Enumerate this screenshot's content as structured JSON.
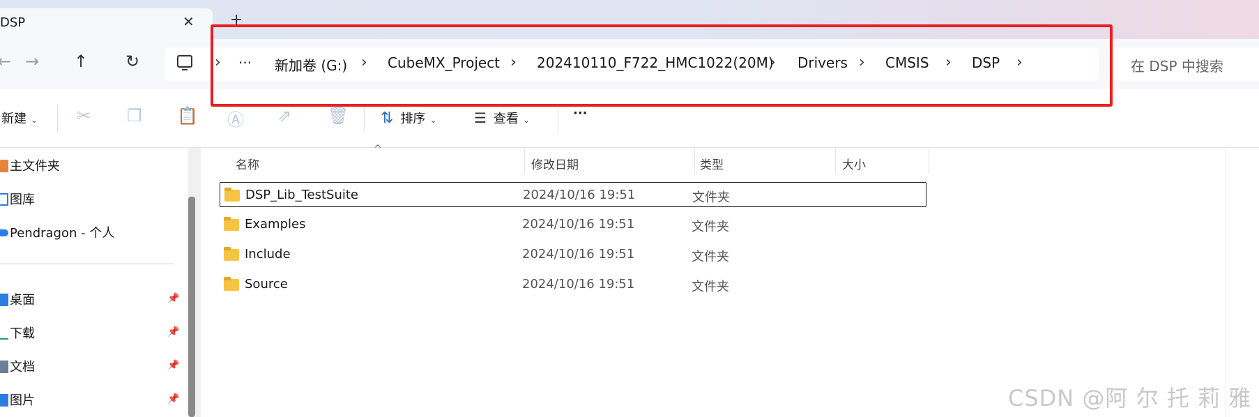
{
  "tab": {
    "title": "DSP",
    "close_icon": "close-icon",
    "new_tab_icon": "plus-icon"
  },
  "nav": {
    "back_icon": "arrow-left-icon",
    "forward_icon": "arrow-right-icon",
    "up_icon": "arrow-up-icon",
    "refresh_icon": "refresh-icon"
  },
  "address": {
    "pc_icon": "this-pc-icon",
    "more": "···",
    "crumbs": [
      "新加卷 (G:)",
      "CubeMX_Project",
      "202410110_F722_HMC1022(20M)",
      "Drivers",
      "CMSIS",
      "DSP"
    ],
    "separator": "›"
  },
  "search": {
    "placeholder": "在 DSP 中搜索"
  },
  "toolbar": {
    "new_label": "新建",
    "sort_label": "排序",
    "view_label": "查看",
    "more_label": "···",
    "icons": [
      "cut-icon",
      "copy-icon",
      "paste-icon",
      "rename-icon",
      "share-icon",
      "delete-icon",
      "sort-icon",
      "view-icon"
    ]
  },
  "sidebar": {
    "items": [
      {
        "label": "主文件夹",
        "icon": "home-icon",
        "color": "#e8833a"
      },
      {
        "label": "图库",
        "icon": "gallery-icon",
        "color": "#2b7de0"
      },
      {
        "label": "Pendragon - 个人",
        "icon": "onedrive-icon",
        "color": "#2b7de0"
      }
    ],
    "pinned": [
      {
        "label": "桌面",
        "icon": "desktop-icon",
        "color": "#2b7de0"
      },
      {
        "label": "下载",
        "icon": "download-icon",
        "color": "#1f9e6e"
      },
      {
        "label": "文档",
        "icon": "documents-icon",
        "color": "#6a7f99"
      },
      {
        "label": "图片",
        "icon": "pictures-icon",
        "color": "#2b7de0"
      }
    ],
    "pin_icon": "pin-icon"
  },
  "columns": {
    "name": "名称",
    "modified": "修改日期",
    "type": "类型",
    "size": "大小"
  },
  "files": [
    {
      "name": "DSP_Lib_TestSuite",
      "modified": "2024/10/16 19:51",
      "type": "文件夹",
      "selected": true
    },
    {
      "name": "Examples",
      "modified": "2024/10/16 19:51",
      "type": "文件夹",
      "selected": false
    },
    {
      "name": "Include",
      "modified": "2024/10/16 19:51",
      "type": "文件夹",
      "selected": false
    },
    {
      "name": "Source",
      "modified": "2024/10/16 19:51",
      "type": "文件夹",
      "selected": false
    }
  ],
  "watermark": "CSDN @阿 尔 托 莉 雅"
}
